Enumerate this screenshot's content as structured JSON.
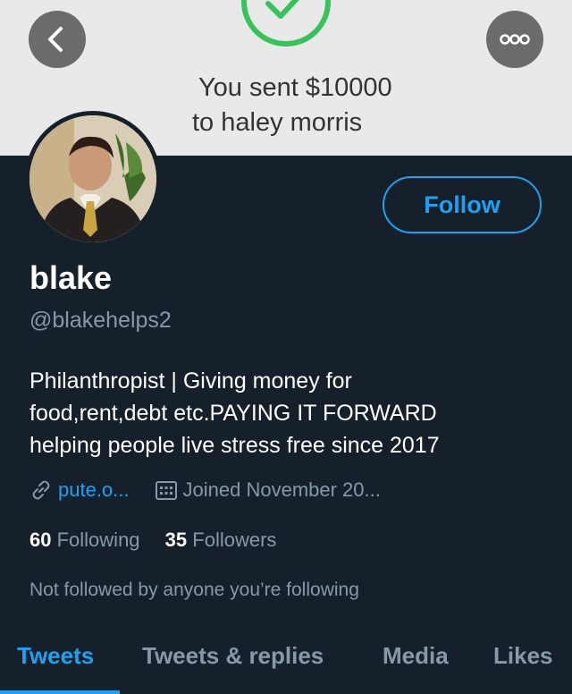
{
  "banner": {
    "line1": "You sent $10000",
    "line2": "to haley morris"
  },
  "icons": {
    "back": "chevron-left-icon",
    "more": "more-dots-icon",
    "check": "checkmark-icon",
    "link": "link-icon",
    "calendar": "calendar-icon"
  },
  "profile": {
    "follow_label": "Follow",
    "name": "blake",
    "handle": "@blakehelps2",
    "bio_lines": [
      "Philanthropist | Giving money for",
      "food,rent,debt etc.PAYING IT FORWARD",
      "helping people live stress free since 2017"
    ],
    "website": "pute.o...",
    "joined": "Joined November 20...",
    "following_count": "60",
    "following_label": "Following",
    "followers_count": "35",
    "followers_label": "Followers",
    "not_followed_text": "Not followed by anyone you’re following"
  },
  "tabs": [
    {
      "label": "Tweets",
      "active": true
    },
    {
      "label": "Tweets & replies",
      "active": false
    },
    {
      "label": "Media",
      "active": false
    },
    {
      "label": "Likes",
      "active": false
    }
  ],
  "colors": {
    "background": "#15202b",
    "accent": "#1da1f2",
    "secondary_text": "#8899a6",
    "check_green": "#36c35a"
  }
}
